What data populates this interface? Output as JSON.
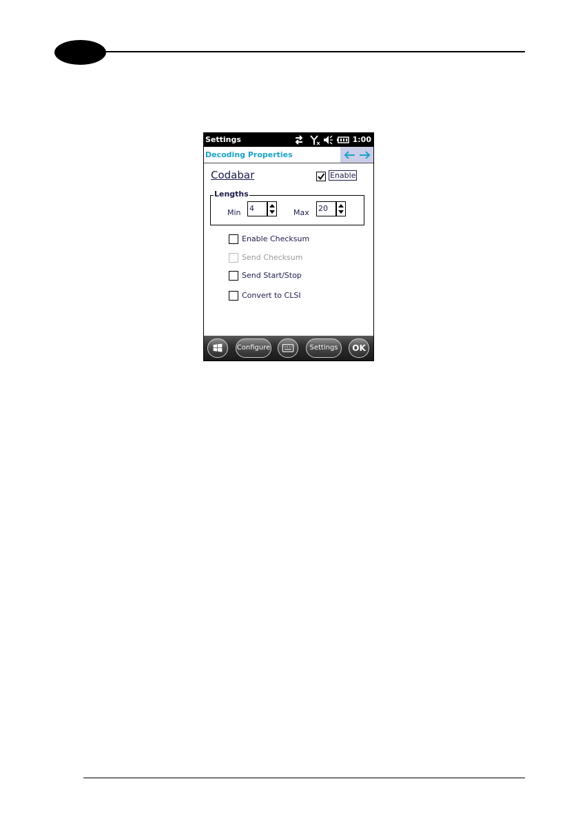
{
  "device": {
    "statusbar": {
      "title": "Settings",
      "time": "1:00"
    },
    "header": {
      "title": "Decoding Properties"
    },
    "codabar": {
      "title": "Codabar",
      "enable_label": "Enable",
      "enable_checked": true
    },
    "lengths": {
      "title": "Lengths",
      "min_label": "Min",
      "min_value": "4",
      "max_label": "Max",
      "max_value": "20"
    },
    "options": [
      {
        "label": "Enable Checksum",
        "checked": false,
        "disabled": false
      },
      {
        "label": "Send Checksum",
        "checked": false,
        "disabled": true
      },
      {
        "label": "Send Start/Stop",
        "checked": false,
        "disabled": false
      },
      {
        "label": "Convert to CLSI",
        "checked": false,
        "disabled": false
      }
    ],
    "taskbar": {
      "configure_label": "Configure",
      "settings_label": "Settings",
      "ok_label": "OK"
    }
  },
  "colors": {
    "header_title": "#1aa3c8",
    "nav_background": "#c9cde7",
    "text": "#1b1b4a"
  },
  "icons": [
    "windows-start-icon",
    "keyboard-icon",
    "connectivity-icon",
    "no-signal-icon",
    "mute-icon",
    "battery-icon",
    "back-arrow-icon",
    "forward-arrow-icon"
  ]
}
